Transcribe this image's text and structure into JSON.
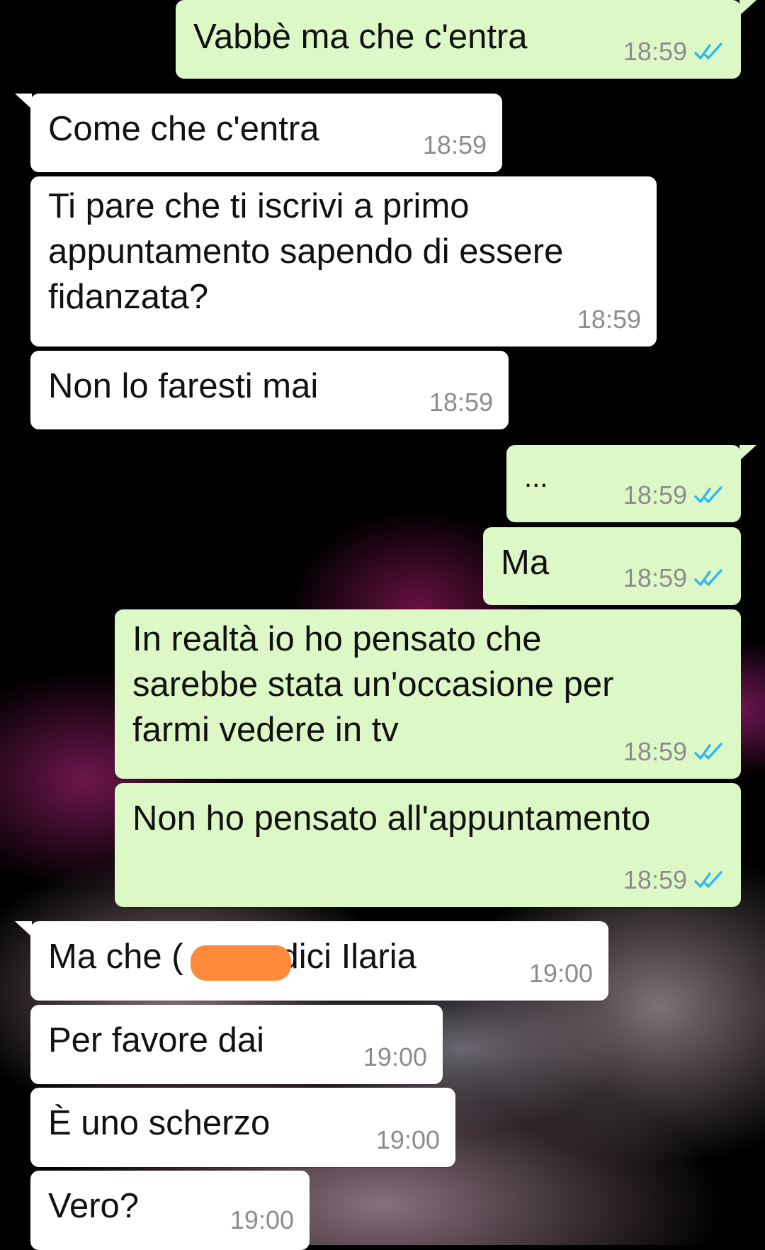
{
  "messages": [
    {
      "direction": "out",
      "text": "Vabbè ma che c'entra",
      "time": "18:59",
      "status_icon": "double-check-read-icon",
      "tail": true
    },
    {
      "direction": "in",
      "text": "Come che c'entra",
      "time": "18:59",
      "tail": true
    },
    {
      "direction": "in",
      "lines": [
        "Ti pare che ti iscrivi a primo",
        "appuntamento sapendo di essere",
        "fidanzata?"
      ],
      "time": "18:59",
      "tail": false
    },
    {
      "direction": "in",
      "text": "Non lo faresti mai",
      "time": "18:59",
      "tail": false
    },
    {
      "direction": "out",
      "text": "...",
      "time": "18:59",
      "status_icon": "double-check-read-icon",
      "tail": true
    },
    {
      "direction": "out",
      "text": "Ma",
      "time": "18:59",
      "status_icon": "double-check-read-icon",
      "tail": false
    },
    {
      "direction": "out",
      "lines": [
        "In realtà io ho pensato che",
        "sarebbe stata un'occasione per",
        "farmi vedere in tv"
      ],
      "time": "18:59",
      "status_icon": "double-check-read-icon",
      "tail": false
    },
    {
      "direction": "out",
      "text": "Non ho pensato all'appuntamento",
      "time": "18:59",
      "status_icon": "double-check-read-icon",
      "tail": false
    },
    {
      "direction": "in",
      "text_before": "Ma che (",
      "text_after": "o dici Ilaria",
      "redacted": true,
      "time": "19:00",
      "tail": true
    },
    {
      "direction": "in",
      "text": "Per favore dai",
      "time": "19:00",
      "tail": false
    },
    {
      "direction": "in",
      "text": "È uno scherzo",
      "time": "19:00",
      "tail": false
    },
    {
      "direction": "in",
      "text": "Vero?",
      "time": "19:00",
      "tail": false
    }
  ],
  "colors": {
    "outgoing_bubble": "#dcf8c6",
    "incoming_bubble": "#ffffff",
    "timestamp": "#8c8c8c",
    "read_ticks": "#34b7f1",
    "redaction": "#ff8a3c"
  }
}
